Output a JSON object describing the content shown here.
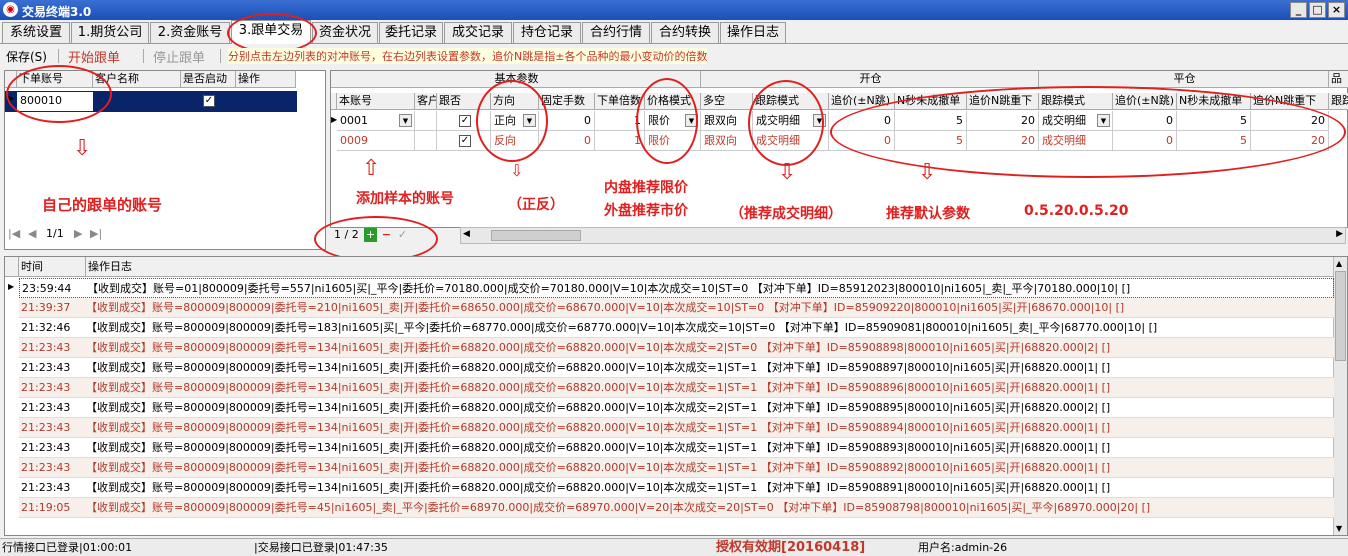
{
  "window": {
    "title": "交易终端3.0",
    "min": "_",
    "max": "□",
    "close": "×"
  },
  "tabs": [
    "系统设置",
    "1.期货公司",
    "2.资金账号",
    "3.跟单交易",
    "资金状况",
    "委托记录",
    "成交记录",
    "持仓记录",
    "合约行情",
    "合约转换",
    "操作日志"
  ],
  "toolbar": {
    "save": "保存(S)",
    "start": "开始跟单",
    "stop": "停止跟单",
    "hint": "分别点击左边列表的对冲账号，在右边列表设置参数，追价N跳是指±各个品种的最小变动价的倍数"
  },
  "left_table": {
    "headers": [
      "下单账号",
      "客户名称",
      "是否启动",
      "操作"
    ],
    "rows": [
      {
        "account": "800010",
        "name": "",
        "enabled": "✓",
        "op": ""
      }
    ],
    "pager": "1/1"
  },
  "right_table": {
    "groups": [
      "基本参数",
      "开仓",
      "平仓",
      "品"
    ],
    "headers": [
      "本账号",
      "客户",
      "跟否",
      "方向",
      "固定手数",
      "下单倍数",
      "价格模式",
      "多空",
      "跟踪模式",
      "追价(±N跳)",
      "N秒未成撤单",
      "追价N跳重下",
      "跟踪模式",
      "追价(±N跳)",
      "N秒未成撤单",
      "追价N跳重下",
      "跟踪"
    ],
    "rows": [
      {
        "acct": "0001",
        "client": "",
        "follow": "✓",
        "dir": "正向",
        "fixed": "0",
        "mult": "1",
        "price": "限价",
        "ls": "跟双向",
        "track": "成交明细",
        "chase": "0",
        "nsec": "5",
        "rechase": "20",
        "track2": "成交明细",
        "chase2": "0",
        "nsec2": "5",
        "rechase2": "20"
      },
      {
        "acct": "0009",
        "client": "",
        "follow": "✓",
        "dir": "反向",
        "fixed": "0",
        "mult": "1",
        "price": "限价",
        "ls": "跟双向",
        "track": "成交明细",
        "chase": "0",
        "nsec": "5",
        "rechase": "20",
        "track2": "成交明细",
        "chase2": "0",
        "nsec2": "5",
        "rechase2": "20"
      }
    ],
    "pager": "1 / 2",
    "add": "+",
    "remove": "−",
    "confirm": "✓"
  },
  "annotations": {
    "own_account": "自己的跟单的账号",
    "add_sample": "添加样本的账号",
    "direction": "（正反）",
    "price_rec_line1": "内盘推荐限价",
    "price_rec_line2": "外盘推荐市价",
    "track_rec": "（推荐成交明细）",
    "default_rec": "推荐默认参数",
    "default_values": "0.5.20.0.5.20"
  },
  "log": {
    "headers": [
      "时间",
      "操作日志"
    ],
    "rows": [
      {
        "time": "23:59:44",
        "msg": "【收到成交】账号=01|800009|委托号=557|ni1605|买|_平今|委托价=70180.000|成交价=70180.000|V=10|本次成交=10|ST=0 【对冲下单】ID=85912023|800010|ni1605|_卖|_平今|70180.000|10| []",
        "red": false
      },
      {
        "time": "21:39:37",
        "msg": "【收到成交】账号=800009|800009|委托号=210|ni1605|_卖|开|委托价=68650.000|成交价=68670.000|V=10|本次成交=10|ST=0 【对冲下单】ID=85909220|800010|ni1605|买|开|68670.000|10| []",
        "red": true
      },
      {
        "time": "21:32:46",
        "msg": "【收到成交】账号=800009|800009|委托号=183|ni1605|买|_平今|委托价=68770.000|成交价=68770.000|V=10|本次成交=10|ST=0 【对冲下单】ID=85909081|800010|ni1605|_卖|_平今|68770.000|10| []",
        "red": false
      },
      {
        "time": "21:23:43",
        "msg": "【收到成交】账号=800009|800009|委托号=134|ni1605|_卖|开|委托价=68820.000|成交价=68820.000|V=10|本次成交=2|ST=0 【对冲下单】ID=85908898|800010|ni1605|买|开|68820.000|2| []",
        "red": true
      },
      {
        "time": "21:23:43",
        "msg": "【收到成交】账号=800009|800009|委托号=134|ni1605|_卖|开|委托价=68820.000|成交价=68820.000|V=10|本次成交=1|ST=1 【对冲下单】ID=85908897|800010|ni1605|买|开|68820.000|1| []",
        "red": false
      },
      {
        "time": "21:23:43",
        "msg": "【收到成交】账号=800009|800009|委托号=134|ni1605|_卖|开|委托价=68820.000|成交价=68820.000|V=10|本次成交=1|ST=1 【对冲下单】ID=85908896|800010|ni1605|买|开|68820.000|1| []",
        "red": true
      },
      {
        "time": "21:23:43",
        "msg": "【收到成交】账号=800009|800009|委托号=134|ni1605|_卖|开|委托价=68820.000|成交价=68820.000|V=10|本次成交=2|ST=1 【对冲下单】ID=85908895|800010|ni1605|买|开|68820.000|2| []",
        "red": false
      },
      {
        "time": "21:23:43",
        "msg": "【收到成交】账号=800009|800009|委托号=134|ni1605|_卖|开|委托价=68820.000|成交价=68820.000|V=10|本次成交=1|ST=1 【对冲下单】ID=85908894|800010|ni1605|买|开|68820.000|1| []",
        "red": true
      },
      {
        "time": "21:23:43",
        "msg": "【收到成交】账号=800009|800009|委托号=134|ni1605|_卖|开|委托价=68820.000|成交价=68820.000|V=10|本次成交=1|ST=1 【对冲下单】ID=85908893|800010|ni1605|买|开|68820.000|1| []",
        "red": false
      },
      {
        "time": "21:23:43",
        "msg": "【收到成交】账号=800009|800009|委托号=134|ni1605|_卖|开|委托价=68820.000|成交价=68820.000|V=10|本次成交=1|ST=1 【对冲下单】ID=85908892|800010|ni1605|买|开|68820.000|1| []",
        "red": true
      },
      {
        "time": "21:23:43",
        "msg": "【收到成交】账号=800009|800009|委托号=134|ni1605|_卖|开|委托价=68820.000|成交价=68820.000|V=10|本次成交=1|ST=1 【对冲下单】ID=85908891|800010|ni1605|买|开|68820.000|1| []",
        "red": false
      },
      {
        "time": "21:19:05",
        "msg": "【收到成交】账号=800009|800009|委托号=45|ni1605|_卖|_平今|委托价=68970.000|成交价=68970.000|V=20|本次成交=20|ST=0 【对冲下单】ID=85908798|800010|ni1605|买|_平今|68970.000|20| []",
        "red": true
      }
    ]
  },
  "status": {
    "quote": "行情接口已登录|01:00:01",
    "trade": "|交易接口已登录|01:47:35",
    "license": "授权有效期[20160418]",
    "user": "用户名:admin-26"
  }
}
